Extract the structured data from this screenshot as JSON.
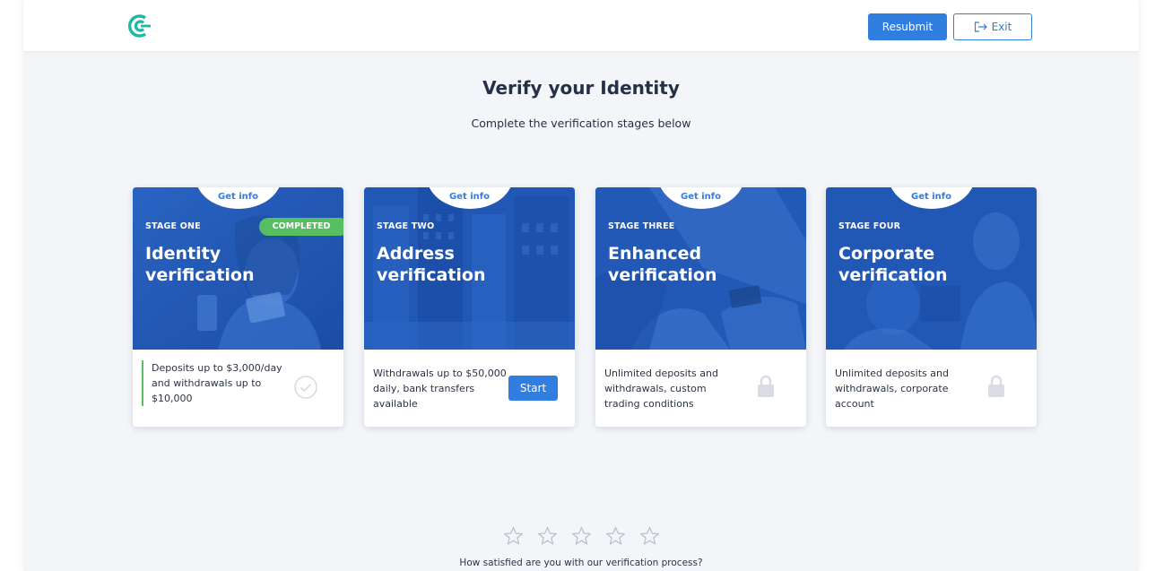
{
  "header": {
    "logo_icon": "ce-logo-icon",
    "resubmit_label": "Resubmit",
    "exit_label": "Exit",
    "exit_icon": "exit-arrow-icon"
  },
  "main": {
    "title": "Verify your Identity",
    "subtitle": "Complete the verification stages below"
  },
  "stages": [
    {
      "get_info": "Get info",
      "stage_label": "STAGE ONE",
      "title": "Identity verification",
      "badge": "COMPLETED",
      "description": "Deposits up to $3,000/day and withdrawals up to $10,000",
      "status": "completed",
      "icon": "check-circle-icon"
    },
    {
      "get_info": "Get info",
      "stage_label": "STAGE TWO",
      "title": "Address verification",
      "description": "Withdrawals up to $50,000 daily, bank transfers available",
      "status": "available",
      "action_label": "Start"
    },
    {
      "get_info": "Get info",
      "stage_label": "STAGE THREE",
      "title": "Enhanced verification",
      "description": "Unlimited deposits and withdrawals, custom trading conditions",
      "status": "locked",
      "icon": "lock-icon"
    },
    {
      "get_info": "Get info",
      "stage_label": "STAGE FOUR",
      "title": "Corporate verification",
      "description": "Unlimited deposits and withdrawals, corporate account",
      "status": "locked",
      "icon": "lock-icon"
    }
  ],
  "feedback": {
    "question": "How satisfied are you with our verification process?",
    "max_stars": 5,
    "selected_stars": 0
  },
  "colors": {
    "accent": "#2f7ee0",
    "success": "#58be62",
    "card_overlay": "#1f56b4",
    "background": "#f3f5f9",
    "text": "#253047"
  }
}
